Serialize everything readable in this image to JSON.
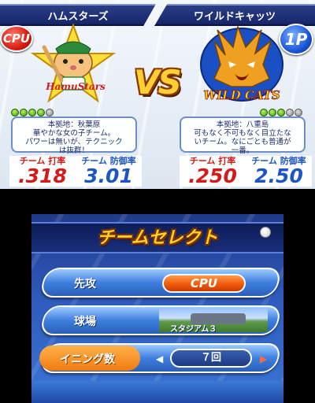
{
  "top": {
    "left_team": {
      "name": "ハムスターズ",
      "controller": "CPU",
      "logo_text": "HamuStars",
      "stars_filled": 4,
      "stars_total": 5,
      "info_lines": [
        "本拠地：秋葉原",
        "華やかな女の子チーム。",
        "パワーは無いが、テクニック",
        "は抜群！"
      ],
      "batting_label": "チーム 打率",
      "batting_value": ".318",
      "era_label": "チーム 防御率",
      "era_value": "3.01"
    },
    "vs_text": "VS",
    "right_team": {
      "name": "ワイルドキャッツ",
      "controller": "1P",
      "logo_text": "WILD CATS",
      "stars_filled": 3,
      "stars_total": 5,
      "info_lines": [
        "本拠地：八重島",
        "可もなく不可もなく目立たな",
        "いチーム。なにごとも普通が",
        "一番。"
      ],
      "batting_label": "チーム 打率",
      "batting_value": ".250",
      "era_label": "チーム 防御率",
      "era_value": "2.50"
    }
  },
  "bottom": {
    "title": "チームセレクト",
    "rows": [
      {
        "label": "先攻",
        "value": "CPU"
      },
      {
        "label": "球場",
        "value": "スタジアム３"
      },
      {
        "label": "イニング数",
        "value": "７回"
      }
    ]
  },
  "colors": {
    "accent_red": "#d51a1a",
    "accent_blue": "#1b56c2",
    "title_yellow": "#ffd21c",
    "cpu_orange": "#f05a0c"
  }
}
